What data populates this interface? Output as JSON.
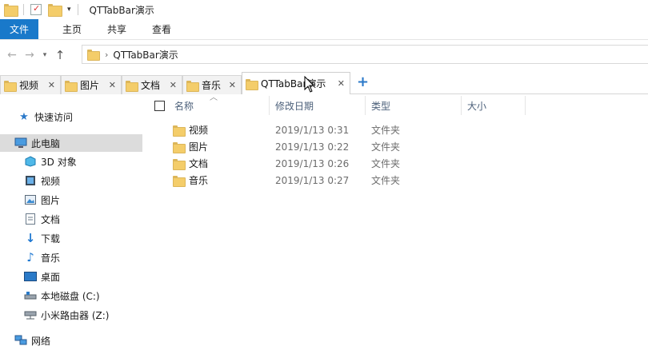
{
  "window": {
    "title": "QTTabBar演示"
  },
  "ribbon": {
    "tabs": [
      "文件",
      "主页",
      "共享",
      "查看"
    ]
  },
  "address": {
    "path": "QTTabBar演示"
  },
  "qt_tabs": [
    {
      "label": "视频"
    },
    {
      "label": "图片"
    },
    {
      "label": "文档"
    },
    {
      "label": "音乐"
    },
    {
      "label": "QTTabBar演示"
    }
  ],
  "navpane": {
    "quick_access": "快速访问",
    "this_pc": "此电脑",
    "items": [
      {
        "label": "3D 对象",
        "icon": "3d-objects-icon"
      },
      {
        "label": "视频",
        "icon": "video-icon"
      },
      {
        "label": "图片",
        "icon": "picture-icon"
      },
      {
        "label": "文档",
        "icon": "document-icon"
      },
      {
        "label": "下载",
        "icon": "download-icon"
      },
      {
        "label": "音乐",
        "icon": "music-icon"
      },
      {
        "label": "桌面",
        "icon": "desktop-icon"
      },
      {
        "label": "本地磁盘 (C:)",
        "icon": "local-disk-icon"
      },
      {
        "label": "小米路由器 (Z:)",
        "icon": "network-drive-icon"
      }
    ],
    "network": "网络"
  },
  "columns": {
    "name": "名称",
    "date": "修改日期",
    "type": "类型",
    "size": "大小"
  },
  "files": [
    {
      "name": "视频",
      "date": "2019/1/13 0:31",
      "type": "文件夹"
    },
    {
      "name": "图片",
      "date": "2019/1/13 0:22",
      "type": "文件夹"
    },
    {
      "name": "文档",
      "date": "2019/1/13 0:26",
      "type": "文件夹"
    },
    {
      "name": "音乐",
      "date": "2019/1/13 0:27",
      "type": "文件夹"
    }
  ],
  "colors": {
    "accent": "#1979ca",
    "folder": "#f4cd6a",
    "selection": "#dcdcdc"
  }
}
